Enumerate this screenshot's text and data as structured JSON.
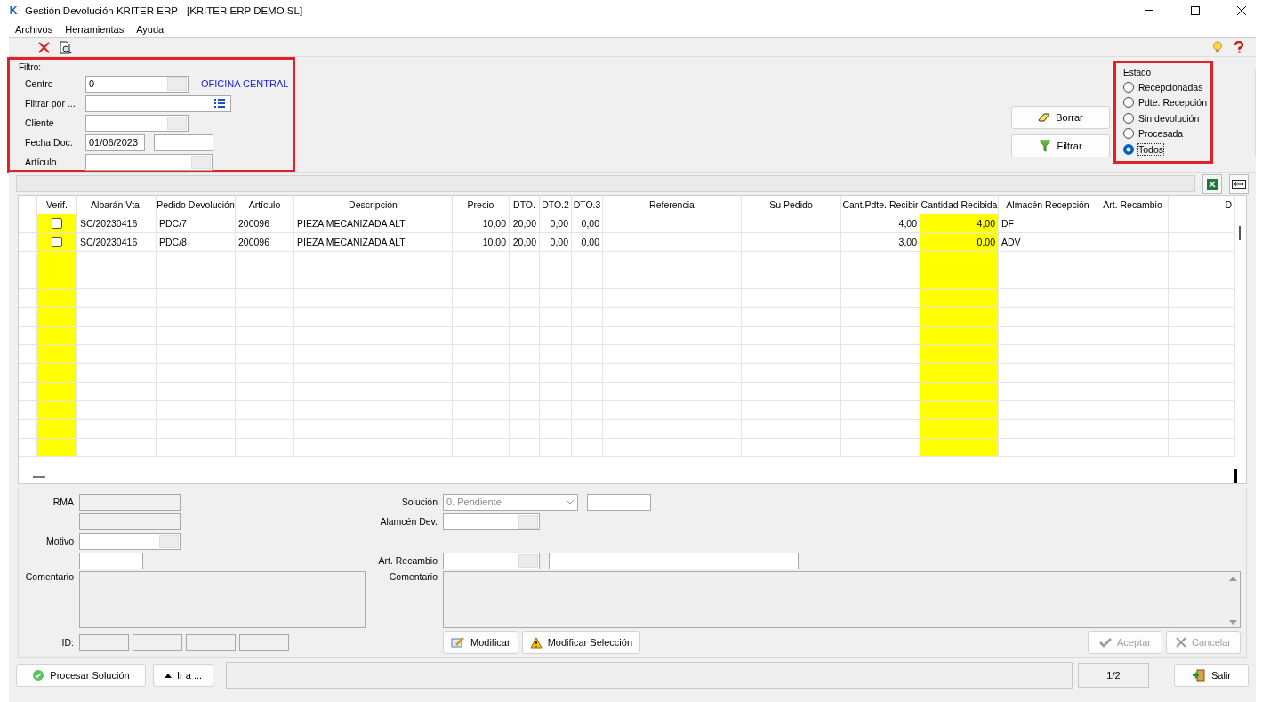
{
  "window": {
    "title": "Gestión Devolución KRITER ERP -  [KRITER ERP DEMO SL]",
    "logo": "K"
  },
  "menu": [
    "Archivos",
    "Herramientas",
    "Ayuda"
  ],
  "filter": {
    "legend": "Filtro:",
    "highlighted": true,
    "fields": [
      {
        "kind": "lookup",
        "label": "Centro",
        "value": "0",
        "note": "OFICINA CENTRAL"
      },
      {
        "kind": "list",
        "label": "Filtrar por ..."
      },
      {
        "kind": "lookup",
        "label": "Cliente"
      },
      {
        "kind": "range",
        "label": "Fecha Doc.",
        "value": "01/06/2023"
      },
      {
        "kind": "picker",
        "label": "Artículo"
      }
    ]
  },
  "actions": [
    {
      "label": "Borrar",
      "kind": "clear"
    },
    {
      "label": "Filtrar",
      "kind": "filter"
    }
  ],
  "estado": {
    "legend": "Estado",
    "highlighted": true,
    "options": [
      {
        "label": "Recepcionadas",
        "selected": false
      },
      {
        "label": "Pdte. Recepción",
        "selected": false
      },
      {
        "label": "Sin devolución",
        "selected": false
      },
      {
        "label": "Procesada",
        "selected": false
      },
      {
        "label": "Todos",
        "selected": true
      }
    ]
  },
  "table": {
    "columns": [
      {
        "label": "Verif.",
        "kind": "check",
        "highlight": true
      },
      {
        "label": "Albarán Vta.",
        "kind": "text",
        "highlight": false
      },
      {
        "label": "Pedido Devolución",
        "kind": "text",
        "highlight": false
      },
      {
        "label": "Artículo",
        "kind": "text",
        "highlight": false
      },
      {
        "label": "Descripción",
        "kind": "text",
        "highlight": false
      },
      {
        "label": "Precio",
        "kind": "number",
        "highlight": false
      },
      {
        "label": "DTO.",
        "kind": "number",
        "highlight": false
      },
      {
        "label": "DTO.2",
        "kind": "number",
        "highlight": false
      },
      {
        "label": "DTO.3",
        "kind": "number",
        "highlight": false
      },
      {
        "label": "Referencia",
        "kind": "text",
        "highlight": false
      },
      {
        "label": "Su Pedido",
        "kind": "text",
        "highlight": false
      },
      {
        "label": "Cant.Pdte. Recibir",
        "kind": "number",
        "highlight": false
      },
      {
        "label": "Cantidad Recibida",
        "kind": "number",
        "highlight": true
      },
      {
        "label": "Almacén Recepción",
        "kind": "text",
        "highlight": false
      },
      {
        "label": "Art. Recambio",
        "kind": "text",
        "highlight": false
      },
      {
        "label": "D",
        "kind": "cut",
        "highlight": false
      }
    ],
    "rows": [
      {
        "checked": false,
        "cells": [
          "",
          "SC/20230416",
          "PDC/7",
          "200096",
          "PIEZA MECANIZADA ALT",
          "10,00",
          "20,00",
          "0,00",
          "0,00",
          null,
          null,
          "4,00",
          "4,00",
          "DF",
          null,
          null
        ]
      },
      {
        "checked": false,
        "cells": [
          "",
          "SC/20230416",
          "PDC/8",
          "200096",
          "PIEZA MECANIZADA ALT",
          "10,00",
          "20,00",
          "0,00",
          "0,00",
          null,
          null,
          "3,00",
          "0,00",
          "ADV",
          null,
          null
        ]
      }
    ]
  },
  "detail": {
    "rma": {
      "label": "RMA",
      "disabled": true
    },
    "motivo": "Motivo",
    "comentario": "Comentario",
    "id": "ID:",
    "solucion": {
      "label": "Solución",
      "value": "0. Pendiente",
      "disabled": true
    },
    "almacen": "Alamcén Dev.",
    "recambio": "Art. Recambio",
    "comentario_solucion": "Comentario",
    "buttons": [
      {
        "label": "Modificar",
        "kind": "edit",
        "disabled": false
      },
      {
        "label": "Modificar Selección",
        "kind": "warning",
        "disabled": false
      }
    ],
    "confirm": [
      {
        "label": "Aceptar",
        "kind": "accept",
        "disabled": true
      },
      {
        "label": "Cancelar",
        "kind": "cancel",
        "disabled": true
      }
    ]
  },
  "footer": {
    "buttons": [
      {
        "label": "Procesar Solución",
        "kind": "process"
      },
      {
        "label": "Ir a ...",
        "kind": "goto"
      }
    ],
    "page": "1/2",
    "exit": "Salir"
  }
}
